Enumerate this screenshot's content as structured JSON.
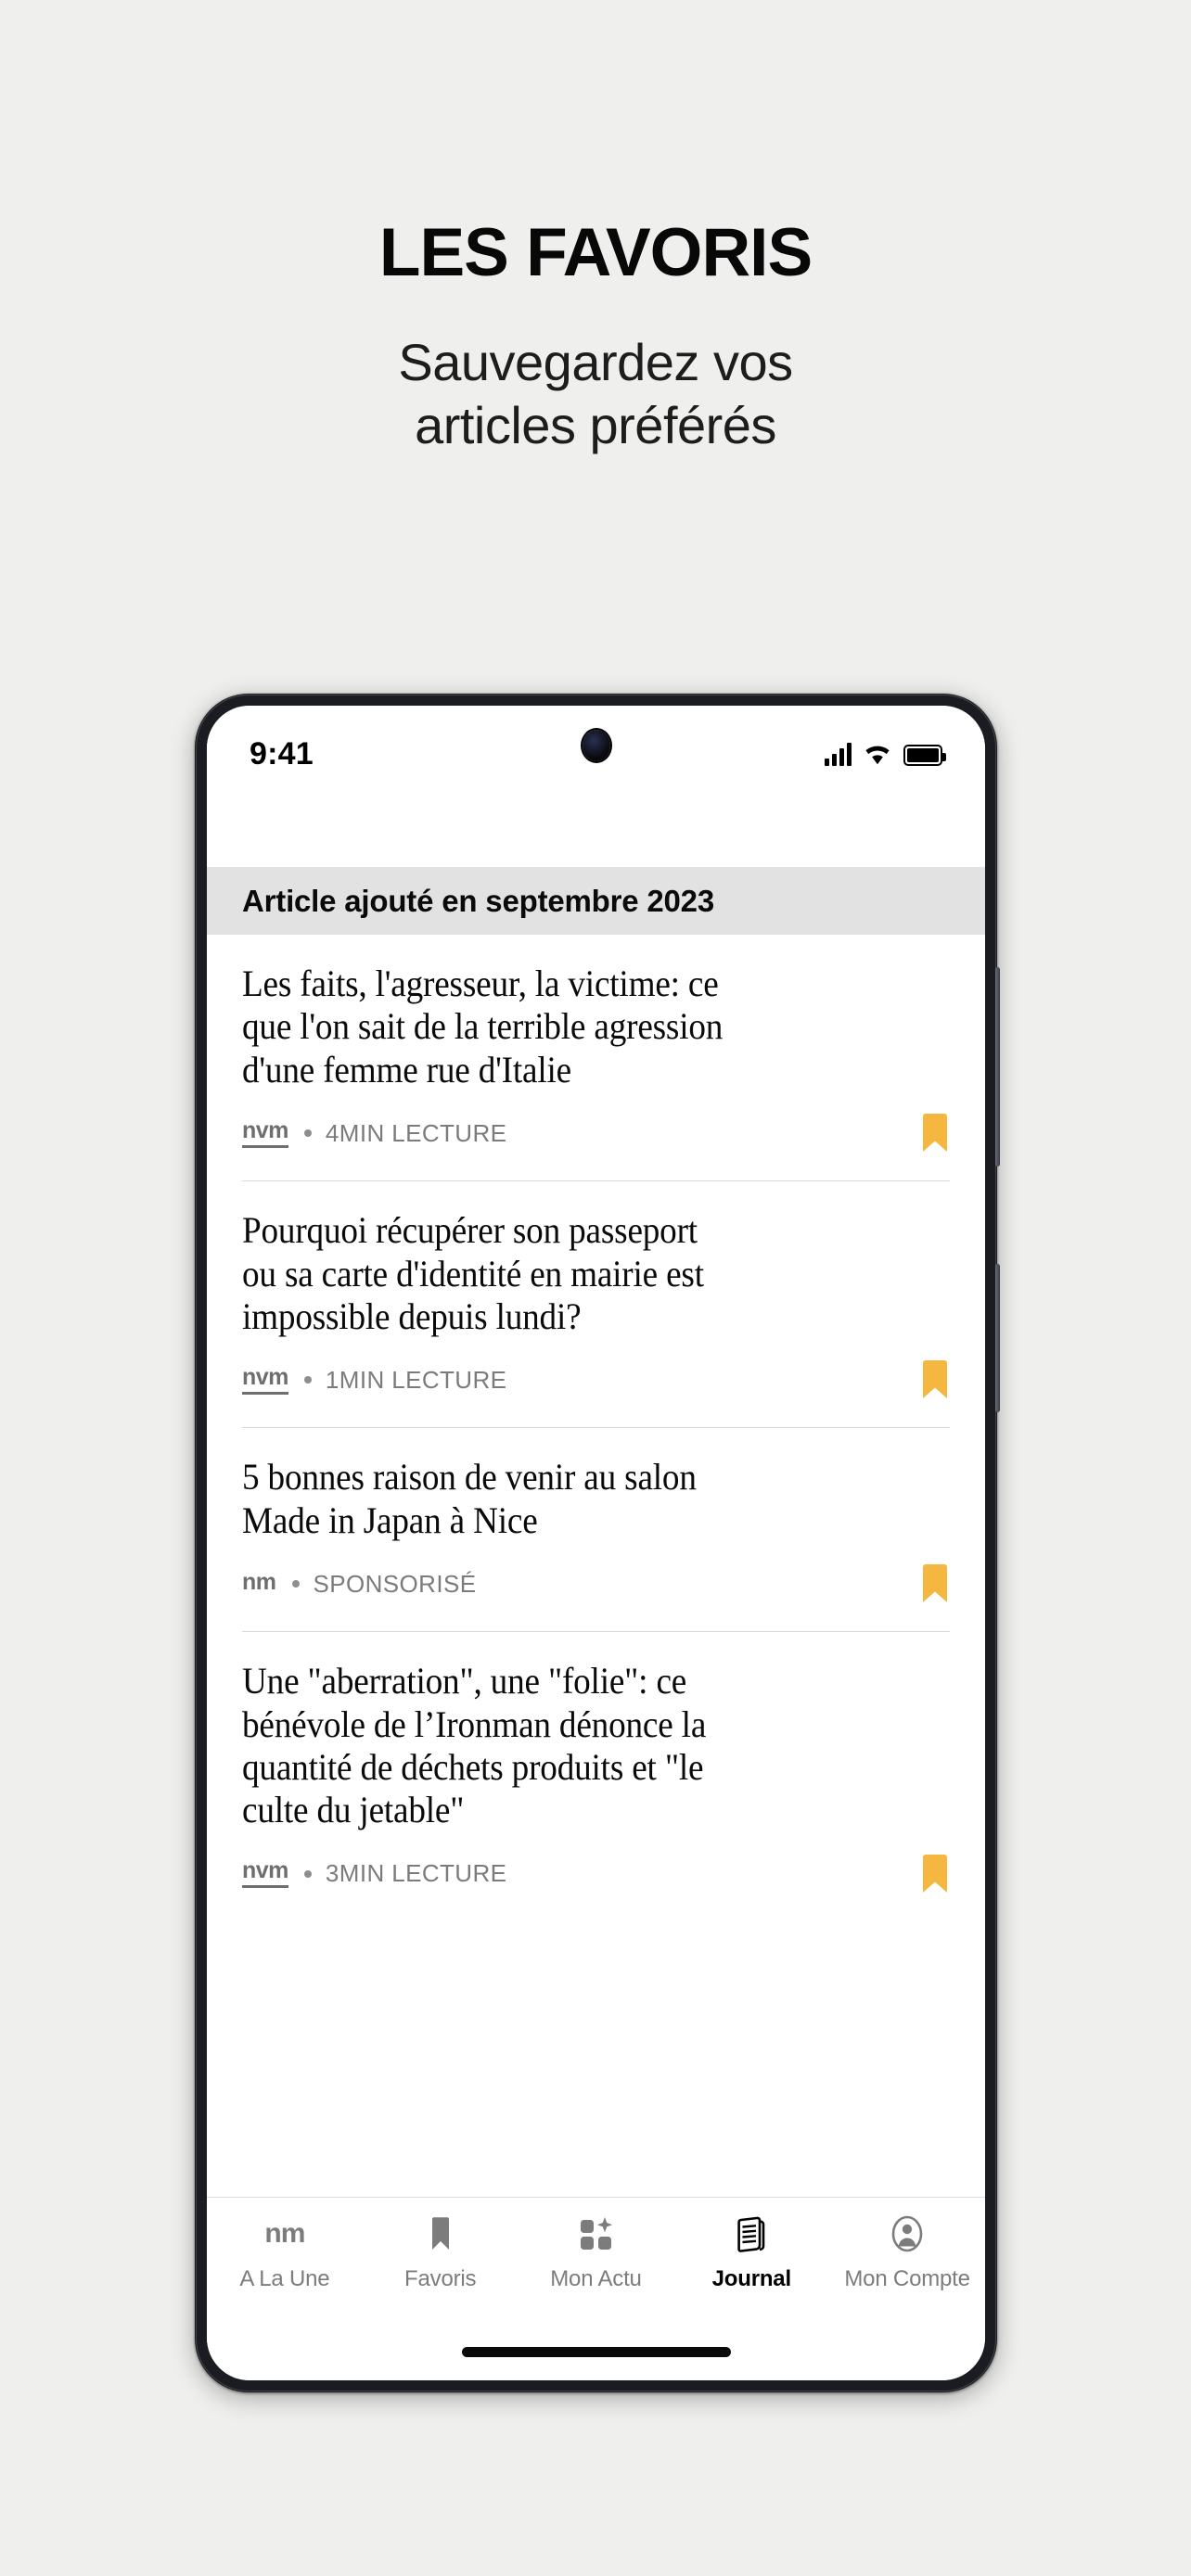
{
  "promo": {
    "title": "LES FAVORIS",
    "subtitle_line1": "Sauvegardez vos",
    "subtitle_line2": "articles préférés"
  },
  "status_bar": {
    "time": "9:41",
    "signal_icon": "cellular-signal-icon",
    "wifi_icon": "wifi-icon",
    "battery_icon": "battery-full-icon"
  },
  "section": {
    "label": "Article ajouté en septembre 2023"
  },
  "colors": {
    "page_background": "#efefed",
    "phone_frame": "#1b1c22",
    "screen": "#ffffff",
    "section_band": "#e2e2e2",
    "bookmark_active": "#f5b740",
    "meta_text": "#7b7b7b",
    "tab_inactive": "#7c7c7c",
    "tab_active": "#000000"
  },
  "articles": [
    {
      "headline": "Les faits, l'agresseur, la victime: ce\nque l'on sait de la terrible agression\nd'une femme rue d'Italie",
      "brand": "nvm",
      "brand_underlined": true,
      "readtime": "4MIN LECTURE",
      "bookmarked": true
    },
    {
      "headline": "Pourquoi récupérer son passeport\nou sa carte d'identité en mairie est\nimpossible depuis lundi?",
      "brand": "nvm",
      "brand_underlined": true,
      "readtime": "1MIN LECTURE",
      "bookmarked": true
    },
    {
      "headline": "5 bonnes raison de venir au salon\nMade in Japan à Nice",
      "brand": "nm",
      "brand_underlined": false,
      "readtime": "SPONSORISÉ",
      "bookmarked": true
    },
    {
      "headline": "Une \"aberration\", une \"folie\": ce\nbénévole de l’Ironman dénonce la\nquantité de déchets produits et \"le\nculte du jetable\"",
      "brand": "nvm",
      "brand_underlined": true,
      "readtime": "3MIN LECTURE",
      "bookmarked": true
    }
  ],
  "tabbar": {
    "items": [
      {
        "label": "A La Une",
        "icon": "nm-logo-icon",
        "active": false
      },
      {
        "label": "Favoris",
        "icon": "bookmark-icon",
        "active": false
      },
      {
        "label": "Mon Actu",
        "icon": "grid-sparkle-icon",
        "active": false
      },
      {
        "label": "Journal",
        "icon": "newspaper-icon",
        "active": true
      },
      {
        "label": "Mon Compte",
        "icon": "account-icon",
        "active": false
      }
    ]
  }
}
